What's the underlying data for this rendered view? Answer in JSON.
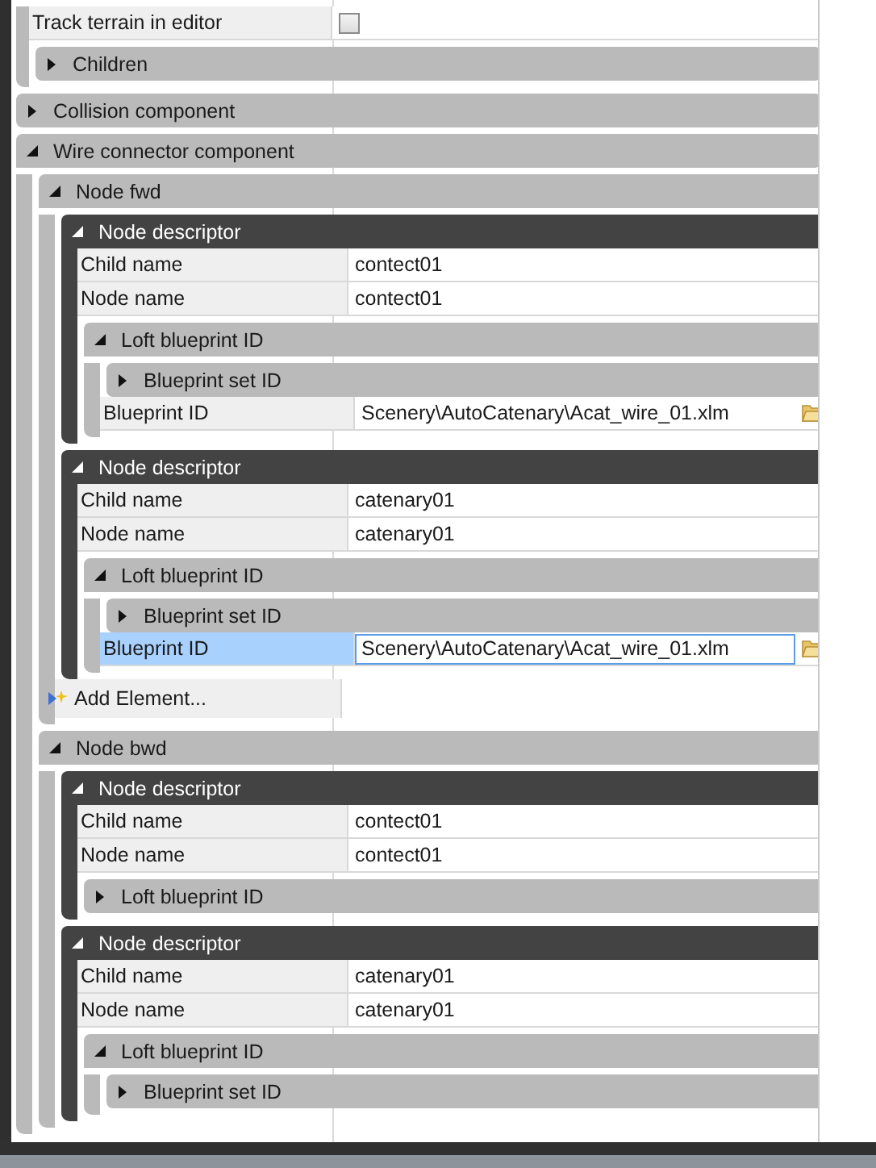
{
  "items": [
    {
      "kind": "continued",
      "children": [
        {
          "kind": "checkbox",
          "label": "Track terrain in editor",
          "checked": false
        },
        {
          "kind": "group",
          "title": "Children",
          "expanded": false
        }
      ]
    },
    {
      "kind": "group",
      "title": "Collision component",
      "expanded": false
    },
    {
      "kind": "group",
      "title": "Wire connector component",
      "expanded": true,
      "children": [
        {
          "kind": "group",
          "title": "Node fwd",
          "expanded": true,
          "children": [
            {
              "kind": "descriptor",
              "title": "Node descriptor",
              "expanded": true,
              "children": [
                {
                  "kind": "text",
                  "label": "Child name",
                  "value": "contect01"
                },
                {
                  "kind": "text",
                  "label": "Node name",
                  "value": "contect01"
                },
                {
                  "kind": "group",
                  "title": "Loft blueprint ID",
                  "expanded": true,
                  "children": [
                    {
                      "kind": "group",
                      "title": "Blueprint set ID",
                      "expanded": false
                    },
                    {
                      "kind": "file",
                      "label": "Blueprint ID",
                      "value": "Scenery\\AutoCatenary\\Acat_wire_01.xlm",
                      "selected": false
                    }
                  ]
                }
              ]
            },
            {
              "kind": "descriptor",
              "title": "Node descriptor",
              "expanded": true,
              "children": [
                {
                  "kind": "text",
                  "label": "Child name",
                  "value": "catenary01"
                },
                {
                  "kind": "text",
                  "label": "Node name",
                  "value": "catenary01"
                },
                {
                  "kind": "group",
                  "title": "Loft blueprint ID",
                  "expanded": true,
                  "children": [
                    {
                      "kind": "group",
                      "title": "Blueprint set ID",
                      "expanded": false
                    },
                    {
                      "kind": "file",
                      "label": "Blueprint ID",
                      "value": "Scenery\\AutoCatenary\\Acat_wire_01.xlm",
                      "selected": true
                    }
                  ]
                }
              ]
            },
            {
              "kind": "add",
              "label": "Add Element..."
            }
          ]
        },
        {
          "kind": "group",
          "title": "Node bwd",
          "expanded": true,
          "children": [
            {
              "kind": "descriptor",
              "title": "Node descriptor",
              "expanded": true,
              "children": [
                {
                  "kind": "text",
                  "label": "Child name",
                  "value": "contect01"
                },
                {
                  "kind": "text",
                  "label": "Node name",
                  "value": "contect01"
                },
                {
                  "kind": "group",
                  "title": "Loft blueprint ID",
                  "expanded": false
                }
              ]
            },
            {
              "kind": "descriptor",
              "title": "Node descriptor",
              "expanded": true,
              "children": [
                {
                  "kind": "text",
                  "label": "Child name",
                  "value": "catenary01"
                },
                {
                  "kind": "text",
                  "label": "Node name",
                  "value": "catenary01"
                },
                {
                  "kind": "group",
                  "title": "Loft blueprint ID",
                  "expanded": true,
                  "children": [
                    {
                      "kind": "group",
                      "title": "Blueprint set ID",
                      "expanded": false
                    }
                  ]
                }
              ]
            }
          ]
        }
      ]
    }
  ]
}
